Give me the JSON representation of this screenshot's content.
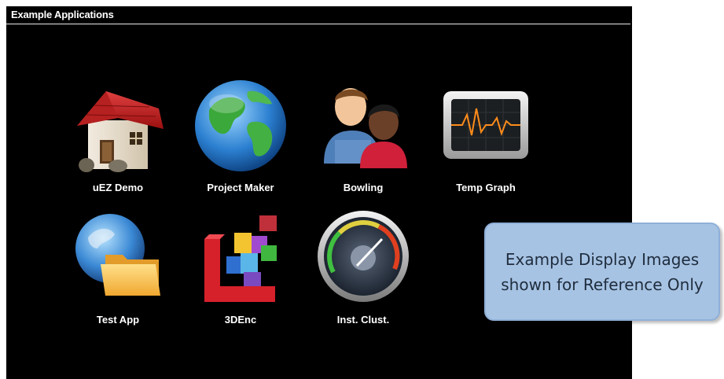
{
  "window": {
    "title": "Example Applications"
  },
  "apps": [
    {
      "label": "uEZ Demo",
      "icon": "house-icon"
    },
    {
      "label": "Project Maker",
      "icon": "globe-icon"
    },
    {
      "label": "Bowling",
      "icon": "people-icon"
    },
    {
      "label": "Temp Graph",
      "icon": "monitor-graph-icon"
    },
    {
      "label": "Test App",
      "icon": "folder-globe-icon"
    },
    {
      "label": "3DEnc",
      "icon": "blocks-icon"
    },
    {
      "label": "Inst. Clust.",
      "icon": "gauge-icon"
    }
  ],
  "callout": {
    "line1": "Example Display Images",
    "line2": "shown for Reference Only"
  },
  "colors": {
    "screen_bg": "#000000",
    "callout_bg": "#a7c3e4",
    "label_text": "#ffffff"
  }
}
